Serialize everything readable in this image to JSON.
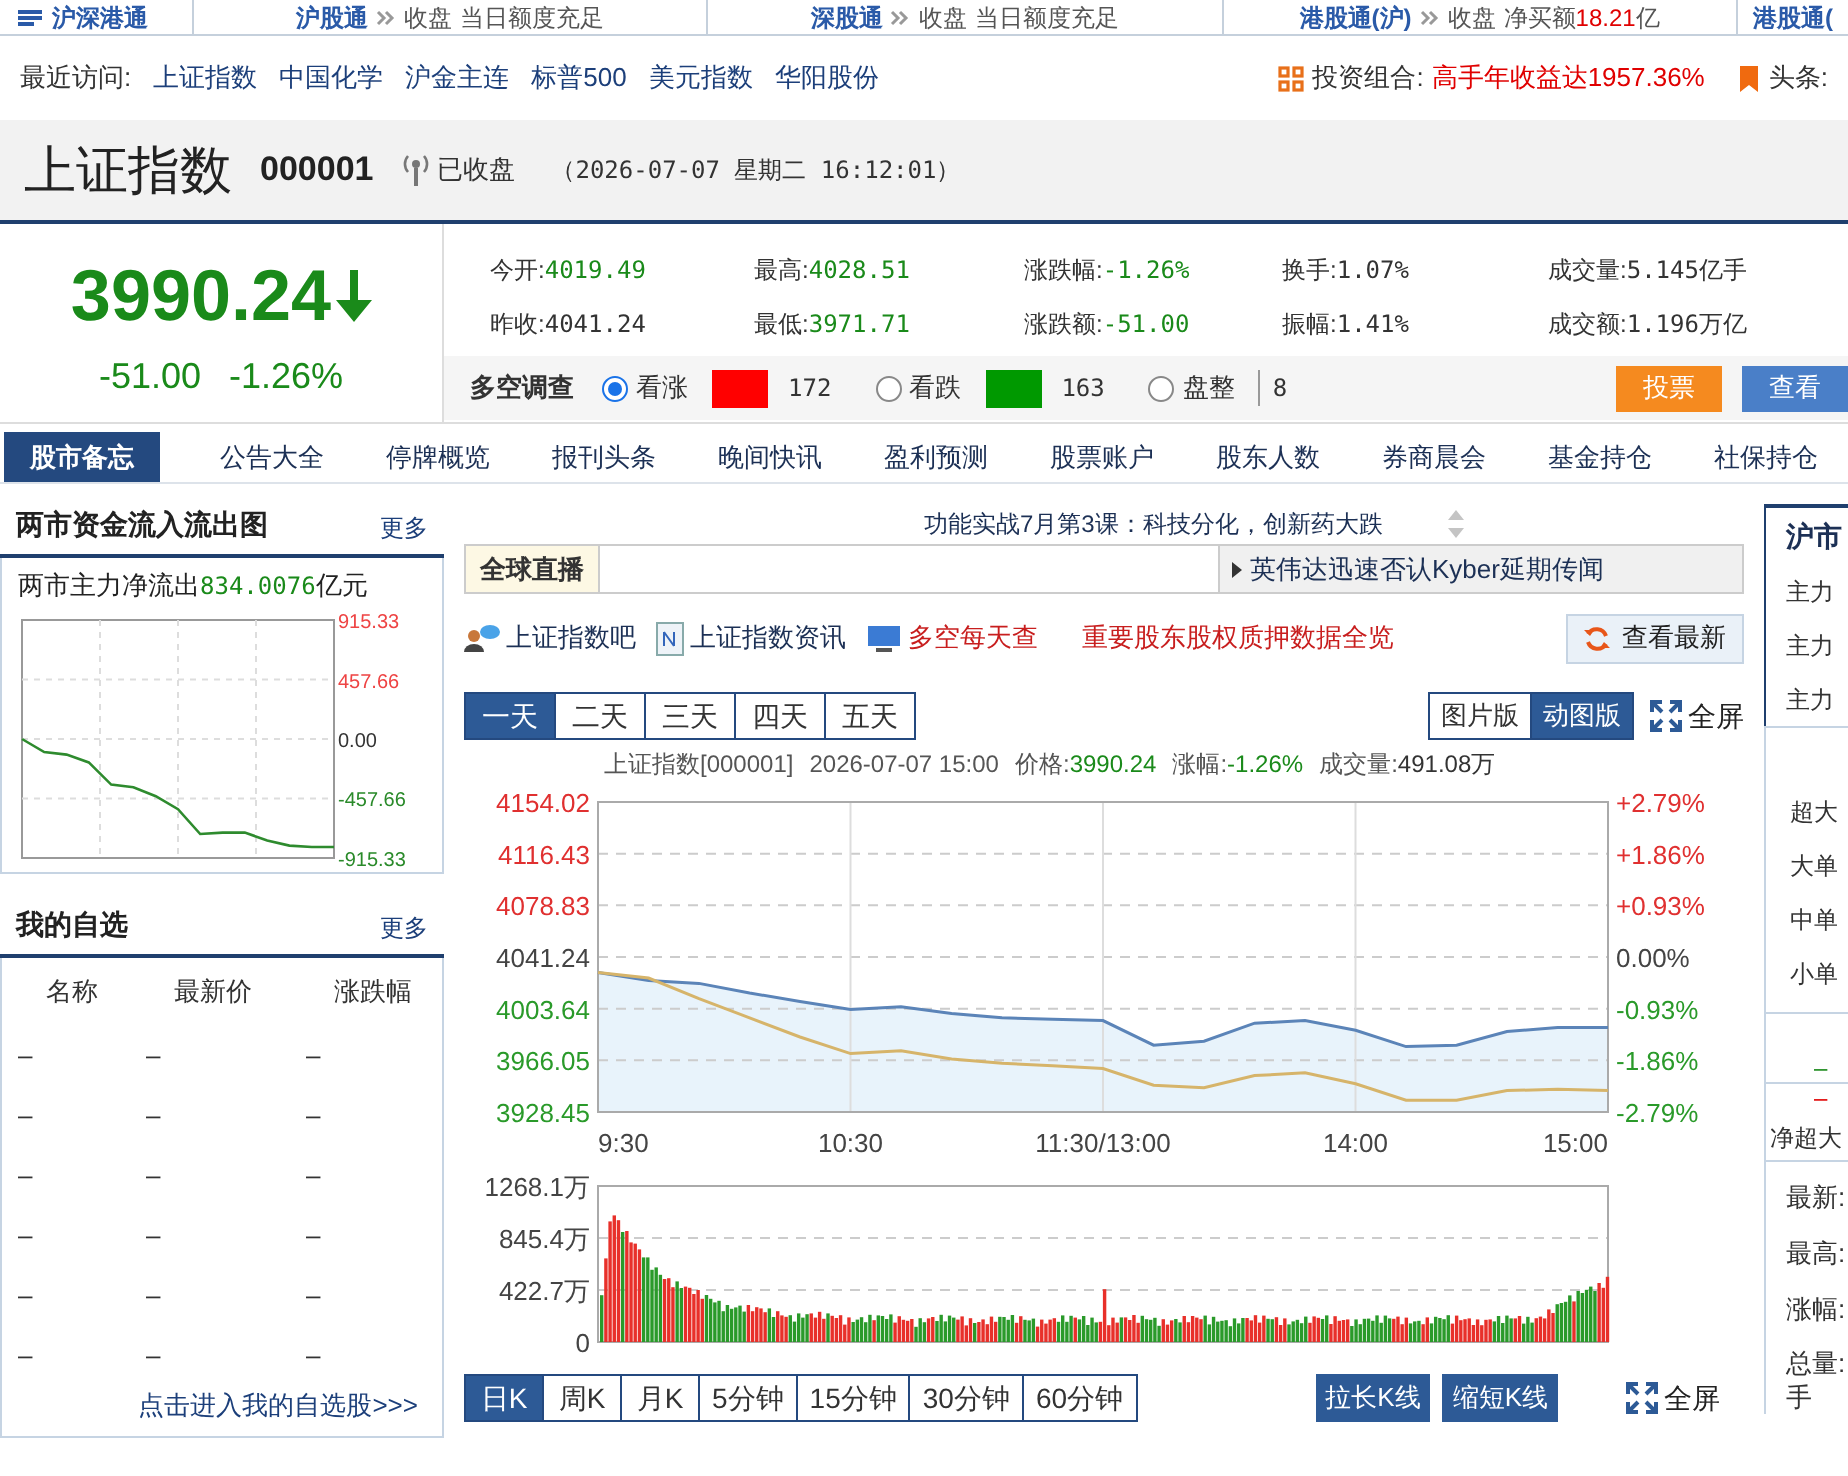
{
  "top_bar": {
    "logo": "沪深港通",
    "items": [
      {
        "name": "沪股通",
        "status": "收盘",
        "detail": "当日额度充足"
      },
      {
        "name": "深股通",
        "status": "收盘",
        "detail": "当日额度充足"
      },
      {
        "name": "港股通(沪)",
        "status": "收盘",
        "detail": "净买额",
        "amount": "18.21",
        "unit": "亿"
      },
      {
        "name": "港股通("
      }
    ]
  },
  "recent": {
    "label": "最近访问:",
    "links": [
      "上证指数",
      "中国化学",
      "沪金主连",
      "标普500",
      "美元指数",
      "华阳股份"
    ]
  },
  "portfolio": {
    "label": "投资组合:",
    "highlight": "高手年收益达1957.36%"
  },
  "headlines": {
    "label": "头条:"
  },
  "security": {
    "name": "上证指数",
    "code": "000001",
    "status": "已收盘",
    "timestamp": "（2026-07-07 星期二 16:12:01）"
  },
  "quote": {
    "price": "3990.24",
    "falling": true,
    "change": "-51.00",
    "change_pct": "-1.26%",
    "stats": [
      {
        "label": "今开:",
        "value": "4019.49",
        "falling": true
      },
      {
        "label": "最高:",
        "value": "4028.51",
        "falling": true
      },
      {
        "label": "涨跌幅:",
        "value": "-1.26%",
        "falling": true
      },
      {
        "label": "换手:",
        "value": "1.07%",
        "falling": false
      },
      {
        "label": "成交量:",
        "value": "5.145亿手",
        "falling": false
      },
      {
        "label": "昨收:",
        "value": "4041.24",
        "falling": false
      },
      {
        "label": "最低:",
        "value": "3971.71",
        "falling": true
      },
      {
        "label": "涨跌额:",
        "value": "-51.00",
        "falling": true
      },
      {
        "label": "振幅:",
        "value": "1.41%",
        "falling": false
      },
      {
        "label": "成交额:",
        "value": "1.196万亿",
        "falling": false
      }
    ]
  },
  "survey": {
    "title": "多空调查",
    "options": [
      {
        "label": "看涨",
        "selected": true,
        "count": "172",
        "color": "#ff0000"
      },
      {
        "label": "看跌",
        "selected": false,
        "count": "163",
        "color": "#009900"
      },
      {
        "label": "盘整",
        "selected": false,
        "count": "8"
      }
    ],
    "buttons": [
      {
        "label": "投票",
        "kind": "vote"
      },
      {
        "label": "查看",
        "kind": "view"
      }
    ]
  },
  "nav": {
    "title": "股市备忘",
    "items": [
      "公告大全",
      "停牌概览",
      "报刊头条",
      "晚间快讯",
      "盈利预测",
      "股票账户",
      "股东人数",
      "券商晨会",
      "基金持仓",
      "社保持仓"
    ]
  },
  "fund_flow": {
    "title": "两市资金流入流出图",
    "more": "更多",
    "caption": "两市主力净流出",
    "amount": "834.0076",
    "unit": "亿元",
    "chart_data": {
      "type": "line",
      "categories": [
        null,
        null,
        null,
        null,
        null,
        null,
        null,
        null,
        null,
        null,
        null,
        null,
        null,
        null,
        null
      ],
      "series": [
        {
          "color": "#2e8b2e",
          "values": [
            0,
            -100,
            -120,
            -180,
            -350,
            -370,
            -440,
            -540,
            -730,
            -720,
            -720,
            -780,
            -820,
            -830,
            -830
          ]
        }
      ],
      "ylim": [
        -915.33,
        915.33
      ],
      "grid": true,
      "yticks": [
        915.33,
        457.66,
        {
          "value": 0,
          "label": "0.00"
        },
        -457.66,
        -915.33
      ]
    }
  },
  "watchlist": {
    "title": "我的自选",
    "more": "更多",
    "columns": [
      "名称",
      "最新价",
      "涨跌幅"
    ],
    "rows": [
      [
        "–",
        "–",
        "–"
      ],
      [
        "–",
        "–",
        "–"
      ],
      [
        "–",
        "–",
        "–"
      ],
      [
        "–",
        "–",
        "–"
      ],
      [
        "–",
        "–",
        "–"
      ],
      [
        "–",
        "–",
        "–"
      ]
    ],
    "link": "点击进入我的自选股>>>"
  },
  "ticker": {
    "headline": "功能实战7月第3课：科技分化，创新药大跌"
  },
  "live": {
    "label": "全球直播",
    "news": "英伟达迅速否认Kyber延期传闻"
  },
  "quick_links": [
    {
      "label": "上证指数吧",
      "kind": "forum"
    },
    {
      "label": "上证指数资讯",
      "kind": "news"
    },
    {
      "label": "多空每天查",
      "kind": "monitor"
    },
    {
      "label": "重要股东股权质押数据全览",
      "kind": "plain"
    }
  ],
  "refresh_button": "查看最新",
  "range_tabs": [
    {
      "label": "一天",
      "selected": true
    },
    {
      "label": "二天",
      "selected": false
    },
    {
      "label": "三天",
      "selected": false
    },
    {
      "label": "四天",
      "selected": false
    },
    {
      "label": "五天",
      "selected": false
    }
  ],
  "view_tabs": [
    {
      "label": "图片版",
      "selected": false
    },
    {
      "label": "动图版",
      "selected": true
    }
  ],
  "fullscreen": "全屏",
  "chart_header": [
    {
      "text": "上证指数[000001]"
    },
    {
      "text": "2026-07-07 15:00"
    },
    {
      "label": "价格:",
      "value": "3990.24",
      "falling": true
    },
    {
      "label": "涨幅:",
      "value": "-1.26%",
      "falling": true
    },
    {
      "label": "成交量:",
      "value": "491.08万",
      "falling": false
    }
  ],
  "price_chart": {
    "chart_data": {
      "type": "line",
      "categories": [
        "9:30",
        null,
        null,
        null,
        null,
        "10:30",
        null,
        null,
        null,
        null,
        "11:30/13:00",
        null,
        null,
        null,
        null,
        "14:00",
        null,
        null,
        null,
        null,
        "15:00"
      ],
      "series": [
        {
          "color": "#5b84b8",
          "values": [
            4030,
            4024,
            4022,
            4015,
            4009,
            4003,
            4005,
            4000,
            3997,
            3996,
            3995,
            3977,
            3980,
            3993,
            3995,
            3988,
            3976,
            3977,
            3987,
            3990,
            3990
          ]
        },
        {
          "color": "#d6b46a",
          "values": [
            4030,
            4026,
            4011,
            3997,
            3983,
            3971,
            3973,
            3967,
            3964,
            3962,
            3960,
            3948,
            3946,
            3955,
            3957,
            3949,
            3937,
            3937,
            3944,
            3945,
            3944
          ]
        }
      ],
      "ylim": [
        3928.45,
        4154.02
      ],
      "grid": true,
      "yticks": [
        4154.02,
        4116.43,
        4078.83,
        4041.24,
        4003.64,
        3966.05,
        3928.45
      ]
    },
    "right_labels": [
      "+2.79%",
      "+1.86%",
      "+0.93%",
      "0.00%",
      "-0.93%",
      "-1.86%",
      "-2.79%"
    ]
  },
  "volume_chart": {
    "y_labels": [
      "1268.1万",
      "845.4万",
      "422.7万",
      "0"
    ]
  },
  "period_tabs": [
    {
      "label": "日K",
      "selected": true
    },
    {
      "label": "周K",
      "selected": false
    },
    {
      "label": "月K",
      "selected": false
    },
    {
      "label": "5分钟",
      "selected": false
    },
    {
      "label": "15分钟",
      "selected": false
    },
    {
      "label": "30分钟",
      "selected": false
    },
    {
      "label": "60分钟",
      "selected": false
    }
  ],
  "kline_buttons": [
    "拉长K线",
    "缩短K线"
  ],
  "fullscreen_bottom": "全屏",
  "side_panel": {
    "title": "沪市",
    "flow_rows": [
      "主力",
      "主力",
      "主力"
    ],
    "order_rows": [
      "超大",
      "大单",
      "中单",
      "小单"
    ],
    "marks": [
      {
        "text": "–",
        "falling": true
      },
      {
        "text": "–",
        "falling": false
      }
    ],
    "net_label": "净超大",
    "stats": [
      "最新:",
      "最高:",
      "涨幅:",
      "总量:"
    ],
    "unit": "手"
  }
}
